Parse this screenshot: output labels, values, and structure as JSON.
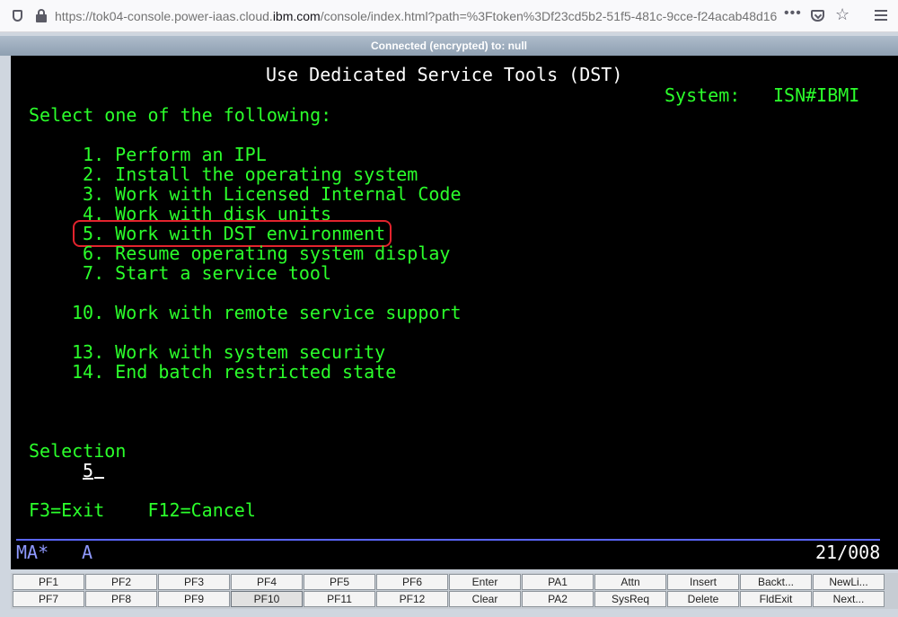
{
  "browser": {
    "url_prefix": "https://tok04-console.power-iaas.cloud.",
    "url_host": "ibm.com",
    "url_suffix": "/console/index.html?path=%3Ftoken%3Df23cd5b2-51f5-481c-9cce-f24acab48d16",
    "icons": [
      "shield-icon",
      "lock-icon",
      "more-icon",
      "pocket-icon",
      "star-icon",
      "menu-icon"
    ]
  },
  "connection": {
    "text": "Connected (encrypted) to: null"
  },
  "screen": {
    "title": "Use Dedicated Service Tools (DST)",
    "system_label": "System:",
    "system_value": "ISN#IBMI",
    "prompt": "Select one of the following:",
    "options": [
      {
        "num": " 1.",
        "label": "Perform an IPL"
      },
      {
        "num": " 2.",
        "label": "Install the operating system"
      },
      {
        "num": " 3.",
        "label": "Work with Licensed Internal Code"
      },
      {
        "num": " 4.",
        "label": "Work with disk units"
      },
      {
        "num": " 5.",
        "label": "Work with DST environment"
      },
      {
        "num": " 6.",
        "label": "Resume operating system display"
      },
      {
        "num": " 7.",
        "label": "Start a service tool"
      },
      {
        "num": "10.",
        "label": "Work with remote service support"
      },
      {
        "num": "13.",
        "label": "Work with system security"
      },
      {
        "num": "14.",
        "label": "End batch restricted state"
      }
    ],
    "highlighted_option": "5",
    "selection_label": "Selection",
    "selection_value": "5",
    "function_keys": "F3=Exit    F12=Cancel",
    "status_left": "MA*",
    "status_mode": "A",
    "status_right": "21/008",
    "highlight_color": "#e3232d",
    "text_color": "#2bff2b"
  },
  "keys": {
    "row1": [
      "PF1",
      "PF2",
      "PF3",
      "PF4",
      "PF5",
      "PF6",
      "Enter",
      "PA1",
      "Attn",
      "Insert",
      "Backt...",
      "NewLi..."
    ],
    "row2": [
      "PF7",
      "PF8",
      "PF9",
      "PF10",
      "PF11",
      "PF12",
      "Clear",
      "PA2",
      "SysReq",
      "Delete",
      "FldExit",
      "Next..."
    ],
    "pressed": "PF10"
  }
}
